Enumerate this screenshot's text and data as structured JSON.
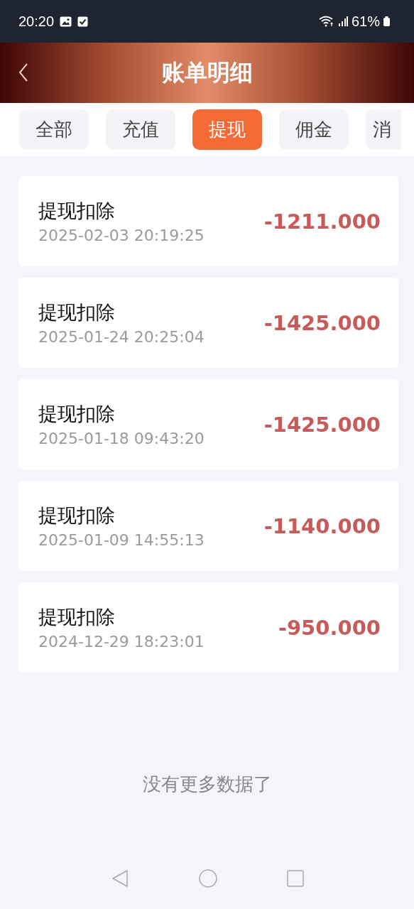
{
  "status_bar": {
    "time": "20:20",
    "battery": "61%"
  },
  "header": {
    "title": "账单明细"
  },
  "tabs": [
    {
      "label": "全部",
      "selected": false
    },
    {
      "label": "充值",
      "selected": false
    },
    {
      "label": "提现",
      "selected": true
    },
    {
      "label": "佣金",
      "selected": false
    },
    {
      "label": "消",
      "selected": false
    }
  ],
  "records": [
    {
      "title": "提现扣除",
      "time": "2025-02-03 20:19:25",
      "amount": "-1211.000"
    },
    {
      "title": "提现扣除",
      "time": "2025-01-24 20:25:04",
      "amount": "-1425.000"
    },
    {
      "title": "提现扣除",
      "time": "2025-01-18 09:43:20",
      "amount": "-1425.000"
    },
    {
      "title": "提现扣除",
      "time": "2025-01-09 14:55:13",
      "amount": "-1140.000"
    },
    {
      "title": "提现扣除",
      "time": "2024-12-29 18:23:01",
      "amount": "-950.000"
    }
  ],
  "footer": "没有更多数据了"
}
